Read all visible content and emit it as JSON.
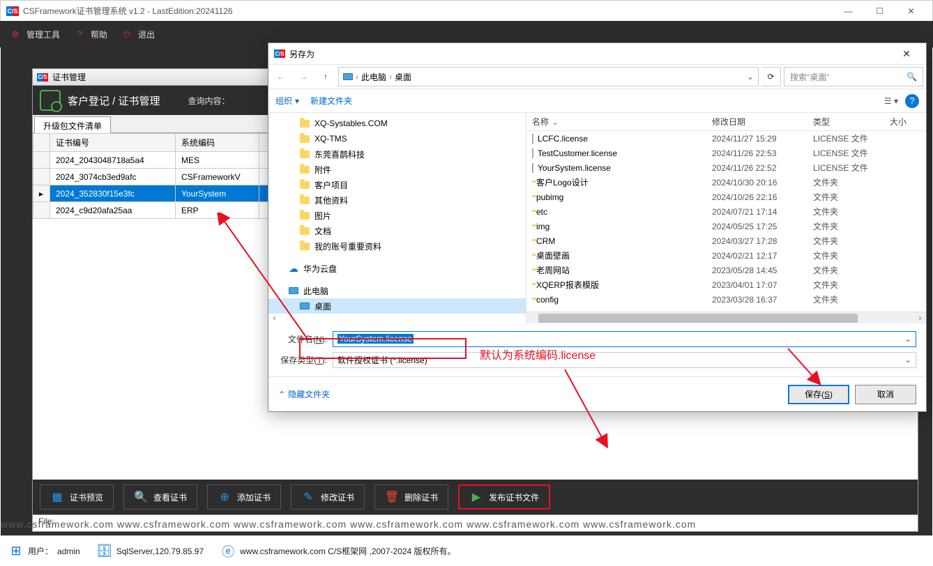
{
  "window": {
    "title": "CSFramework证书管理系统 v1.2 - LastEdition:20241126"
  },
  "menu": {
    "tools": "管理工具",
    "help": "帮助",
    "exit": "退出"
  },
  "inner": {
    "title": "证书管理",
    "heading": "客户登记 / 证书管理",
    "query_label": "查询内容：",
    "tab": "升级包文件清单"
  },
  "grid": {
    "cols": {
      "cert": "证书编号",
      "sys": "系统编码"
    },
    "rows": [
      {
        "cert": "2024_2043048718a5a4",
        "sys": "MES"
      },
      {
        "cert": "2024_3074cb3ed9afc",
        "sys": "CSFrameworkV"
      },
      {
        "cert": "2024_352830f15e3fc",
        "sys": "YourSystem",
        "sel": true
      },
      {
        "cert": "2024_c9d20afa25aa",
        "sys": "ERP"
      }
    ]
  },
  "actions": {
    "preview": "证书预览",
    "view": "查看证书",
    "add": "添加证书",
    "edit": "修改证书",
    "del": "删除证书",
    "publish": "发布证书文件"
  },
  "filebar": "File:",
  "dialog": {
    "title": "另存为",
    "breadcrumb": {
      "pc": "此电脑",
      "desktop": "桌面"
    },
    "search_placeholder": "搜索\"桌面\"",
    "organize": "组织",
    "newfolder": "新建文件夹",
    "cols": {
      "name": "名称",
      "date": "修改日期",
      "type": "类型",
      "size": "大小"
    },
    "tree": [
      {
        "label": "XQ-Systables.COM",
        "lvl": 1
      },
      {
        "label": "XQ-TMS",
        "lvl": 1
      },
      {
        "label": "东莞喜鹊科技",
        "lvl": 1
      },
      {
        "label": "附件",
        "lvl": 1
      },
      {
        "label": "客户项目",
        "lvl": 1
      },
      {
        "label": "其他资料",
        "lvl": 1
      },
      {
        "label": "图片",
        "lvl": 1
      },
      {
        "label": "文档",
        "lvl": 1
      },
      {
        "label": "我的账号重要资料",
        "lvl": 1
      },
      {
        "label": "华为云盘",
        "lvl": 0,
        "icon": "cloud",
        "spacer": true
      },
      {
        "label": "此电脑",
        "lvl": 0,
        "icon": "pc",
        "spacer": true
      },
      {
        "label": "桌面",
        "lvl": 1,
        "icon": "pc",
        "selected": true
      }
    ],
    "files": [
      {
        "name": "LCFC.license",
        "date": "2024/11/27 15:29",
        "type": "LICENSE 文件",
        "icon": "file"
      },
      {
        "name": "TestCustomer.license",
        "date": "2024/11/26 22:53",
        "type": "LICENSE 文件",
        "icon": "file"
      },
      {
        "name": "YourSystem.license",
        "date": "2024/11/26 22:52",
        "type": "LICENSE 文件",
        "icon": "file"
      },
      {
        "name": "客户Logo设计",
        "date": "2024/10/30 20:16",
        "type": "文件夹",
        "icon": "folder"
      },
      {
        "name": "pubimg",
        "date": "2024/10/26 22:16",
        "type": "文件夹",
        "icon": "folder"
      },
      {
        "name": "etc",
        "date": "2024/07/21 17:14",
        "type": "文件夹",
        "icon": "folder"
      },
      {
        "name": "img",
        "date": "2024/05/25 17:25",
        "type": "文件夹",
        "icon": "folder"
      },
      {
        "name": "CRM",
        "date": "2024/03/27 17:28",
        "type": "文件夹",
        "icon": "folder"
      },
      {
        "name": "桌面壁画",
        "date": "2024/02/21 12:17",
        "type": "文件夹",
        "icon": "folder"
      },
      {
        "name": "老周网站",
        "date": "2023/05/28 14:45",
        "type": "文件夹",
        "icon": "folder"
      },
      {
        "name": "XQERP报表模版",
        "date": "2023/04/01 17:07",
        "type": "文件夹",
        "icon": "folder"
      },
      {
        "name": "config",
        "date": "2023/03/28 16:37",
        "type": "文件夹",
        "icon": "folder"
      }
    ],
    "filename_label": "文件名(N):",
    "filename_value": "YourSystem.license",
    "filetype_label": "保存类型(T):",
    "filetype_value": "软件授权证书 (*.license)",
    "hide_folders": "隐藏文件夹",
    "save": "保存(S)",
    "cancel": "取消"
  },
  "annotation": "默认为系统编码.license",
  "status": {
    "user_label": "用户：",
    "user": "admin",
    "db": "SqlServer,120.79.85.97",
    "site": "www.csframework.com C/S框架网 ,2007-2024 版权所有。"
  },
  "watermark": "www.csframework.com      www.csframework.com      www.csframework.com      www.csframework.com      www.csframework.com      www.csframework.com"
}
